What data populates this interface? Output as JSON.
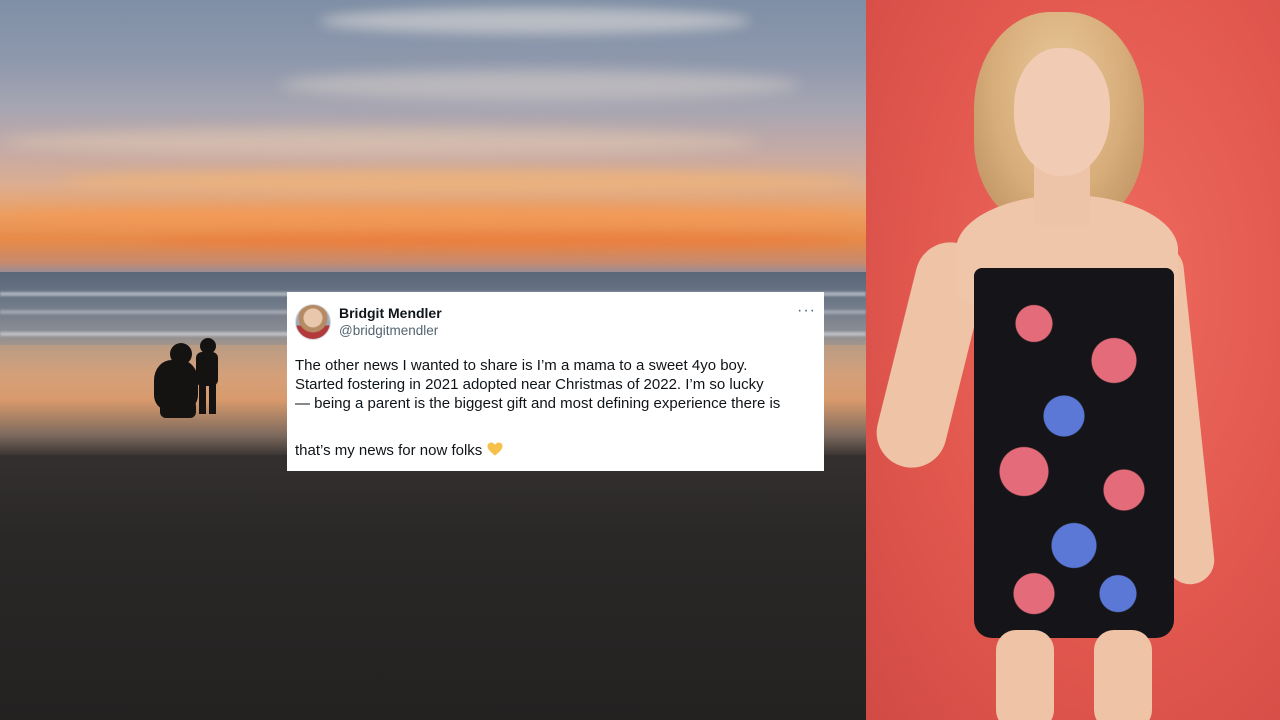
{
  "tweet": {
    "display_name": "Bridgit Mendler",
    "handle": "@bridgitmendler",
    "more_icon": "more-horizontal-icon",
    "lines": [
      "The other news I wanted to share is I’m a mama to a sweet 4yo boy.",
      "Started fostering in 2021 adopted near Christmas of 2022. I’m so lucky",
      "— being a parent is the biggest gift and most defining experience there is"
    ],
    "closing": "that’s my news for now folks",
    "emoji": "yellow-heart-icon",
    "emoji_color": "#f6c14b"
  },
  "images": {
    "left": "beach-sunset-photo",
    "right": "portrait-photo"
  },
  "colors": {
    "backdrop_red": "#e2584f",
    "tweet_bg": "#ffffff",
    "text_primary": "#0f1419",
    "text_secondary": "#536471"
  }
}
